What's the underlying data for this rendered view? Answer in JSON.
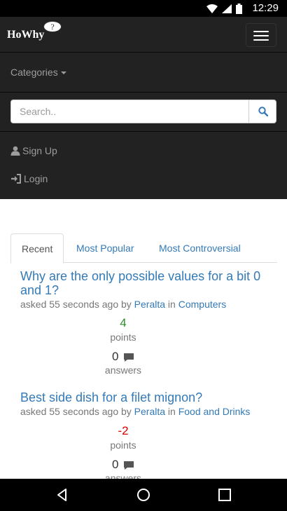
{
  "status_bar": {
    "time": "12:29"
  },
  "navbar": {
    "brand": "HoWhy",
    "brand_bubble": "?",
    "categories_label": "Categories",
    "search_placeholder": "Search..",
    "signup_label": "Sign Up",
    "login_label": "Login"
  },
  "tabs": [
    {
      "label": "Recent",
      "active": true
    },
    {
      "label": "Most Popular",
      "active": false
    },
    {
      "label": "Most Controversial",
      "active": false
    }
  ],
  "questions": [
    {
      "title": "Why are the only possible values for a bit 0 and 1?",
      "asked_prefix": "asked 55 seconds ago by",
      "author": "Peralta",
      "in_word": "in",
      "category": "Computers",
      "points": "4",
      "points_label": "points",
      "answers": "0",
      "answers_label": "answers"
    },
    {
      "title": "Best side dish for a filet mignon?",
      "asked_prefix": "asked 55 seconds ago by",
      "author": "Peralta",
      "in_word": "in",
      "category": "Food and Drinks",
      "points": "-2",
      "points_label": "points",
      "answers": "0",
      "answers_label": "answers"
    }
  ],
  "colors": {
    "positive_points": "#2e8b2e",
    "negative_points": "#e00000",
    "link": "#337ab7"
  }
}
